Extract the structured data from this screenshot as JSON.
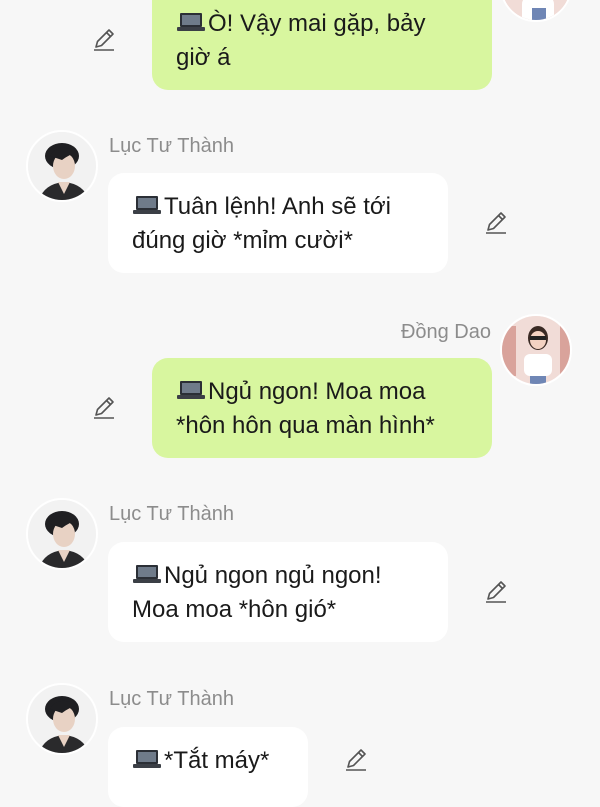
{
  "contacts": {
    "other": "Lục Tư Thành",
    "me": "Đồng Dao"
  },
  "messages": [
    {
      "sender": "",
      "lines": [
        "Ò! Vậy mai gặp, bảy",
        "giờ á"
      ]
    },
    {
      "sender": "Lục Tư Thành",
      "lines": [
        "Tuân lệnh! Anh sẽ tới",
        "đúng giờ *mỉm cười*"
      ]
    },
    {
      "sender": "Đồng Dao",
      "lines": [
        "Ngủ ngon! Moa moa",
        "*hôn hôn qua màn hình*"
      ]
    },
    {
      "sender": "Lục Tư Thành",
      "lines": [
        "Ngủ ngon ngủ ngon!",
        "Moa moa *hôn gió*"
      ]
    },
    {
      "sender": "Lục Tư Thành",
      "lines": [
        "*Tắt máy*"
      ]
    }
  ],
  "icons": {
    "device": "laptop-icon",
    "edit": "pencil-edit-icon",
    "avatar_other": "avatar-photo",
    "avatar_me": "avatar-photo"
  },
  "colors": {
    "background": "#f7f7f7",
    "incoming_bubble": "#ffffff",
    "outgoing_bubble": "#d8f69f",
    "sender_name": "#8c8c8c",
    "text": "#1a1a1a"
  }
}
